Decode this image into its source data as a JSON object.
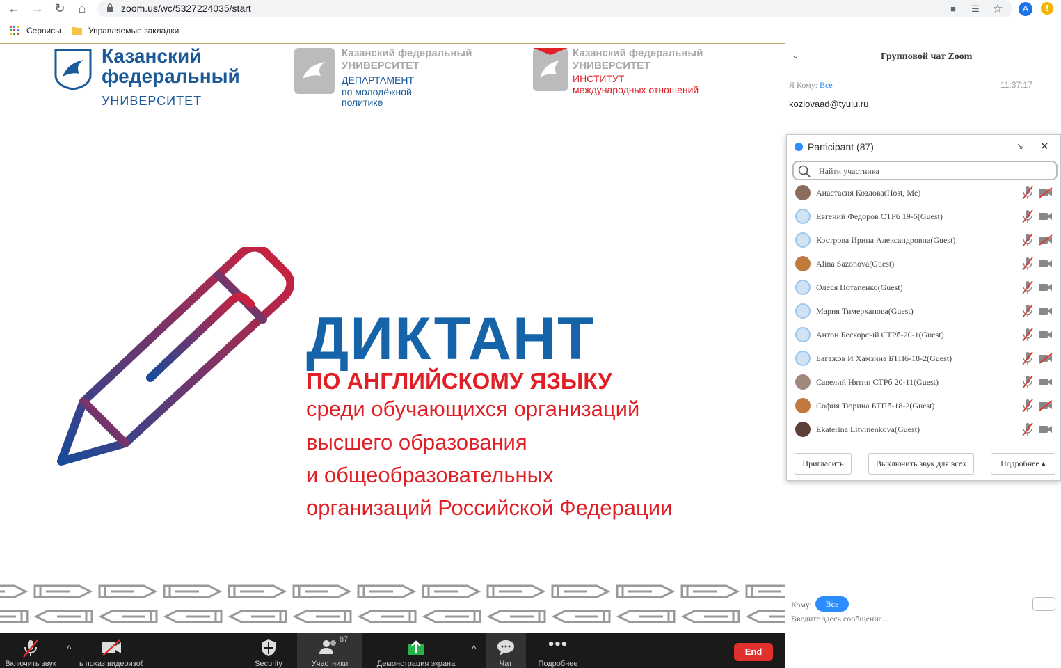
{
  "browser": {
    "url": "zoom.us/wc/5327224035/start",
    "bookmarks": [
      "Сервисы",
      "Управляемые закладки"
    ],
    "profile_initial": "A"
  },
  "slide": {
    "logo1": {
      "line1": "Казанский",
      "line2": "федеральный",
      "line3": "УНИВЕРСИТЕТ"
    },
    "logo2": {
      "line1": "Казанский федеральный",
      "line2": "УНИВЕРСИТЕТ",
      "line3": "ДЕПАРТАМЕНТ",
      "line4": "по молодёжной",
      "line5": "политике"
    },
    "logo3": {
      "line1": "Казанский федеральный",
      "line2": "УНИВЕРСИТЕТ",
      "line3": "ИНСТИТУТ",
      "line4": "международных отношений"
    },
    "title": "ДИКТАНТ",
    "subtitle": "ПО АНГЛИЙСКОМУ ЯЗЫКУ",
    "lines": [
      "среди обучающихся организаций",
      "высшего образования",
      "и общеобразовательных",
      "организаций Российской Федерации"
    ],
    "colors": {
      "blue": "#1563a8",
      "red": "#e01f26"
    }
  },
  "toolbar": {
    "mute_label": "Включить звук",
    "video_label": "ь показ видеоизоб",
    "security_label": "Security",
    "participants_label": "Участники",
    "participants_count": "87",
    "share_label": "Демонстрация экрана",
    "chat_label": "Чат",
    "more_label": "Подробнее",
    "end_label": "End"
  },
  "chat": {
    "title": "Групповой чат Zoom",
    "message": {
      "from": "Я Кому:",
      "to": "Все",
      "time": "11:37:17",
      "text": "kozlovaad@tyuiu.ru"
    },
    "to_label": "Кому:",
    "to_value": "Все",
    "more": "...",
    "input_placeholder": "Введите здесь сообщение..."
  },
  "participants": {
    "title": "Participant (87)",
    "search_placeholder": "Найти участника",
    "items": [
      {
        "name": "Анастасия Козлова(Host, Me)",
        "avatar": "photo",
        "cam_off": true
      },
      {
        "name": "Евгений Федоров СТРб 19-5(Guest)",
        "avatar": "default",
        "cam_off": false
      },
      {
        "name": "Кострова Ирина Александровна(Guest)",
        "avatar": "default",
        "cam_off": true
      },
      {
        "name": "Alina Sazonova(Guest)",
        "avatar": "photo",
        "cam_off": false
      },
      {
        "name": "Олеся Потапенко(Guest)",
        "avatar": "default",
        "cam_off": false
      },
      {
        "name": "Мария Тимерханова(Guest)",
        "avatar": "default",
        "cam_off": false
      },
      {
        "name": "Антон Бескорсый СТРб-20-1(Guest)",
        "avatar": "default",
        "cam_off": false
      },
      {
        "name": "Багажов И Хамзина БТПб-18-2(Guest)",
        "avatar": "default",
        "cam_off": true
      },
      {
        "name": "Савелий Нятин СТРб 20-11(Guest)",
        "avatar": "photo",
        "cam_off": false
      },
      {
        "name": "София Тюрина БТПб-18-2(Guest)",
        "avatar": "photo",
        "cam_off": true
      },
      {
        "name": "Ekaterina Litvinenkova(Guest)",
        "avatar": "photo",
        "cam_off": false
      }
    ],
    "invite_label": "Пригласить",
    "mute_all_label": "Выключить звук для всех",
    "more_label": "Подробнее ▴"
  }
}
